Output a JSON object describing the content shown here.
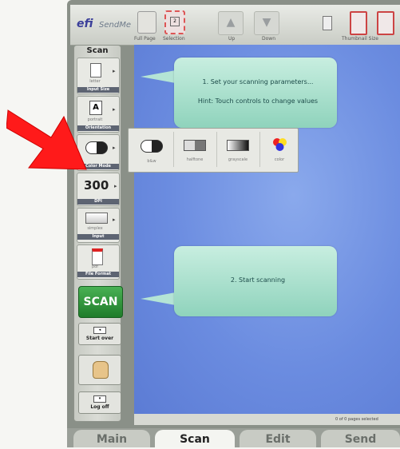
{
  "app": {
    "brand": "efi",
    "name": "SendMe"
  },
  "toolbar": {
    "full_page": "Full Page",
    "selection": "Selection",
    "up": "Up",
    "down": "Down",
    "thumbnail_size": "Thumbnail Size"
  },
  "panel": {
    "title": "Scan",
    "input_size": {
      "value": "letter",
      "caption": "Input Size"
    },
    "orientation": {
      "value": "portrait",
      "caption": "Orientation"
    },
    "color_mode": {
      "caption": "Color Mode"
    },
    "dpi": {
      "value": "300",
      "caption": "DPI"
    },
    "input": {
      "value": "simplex",
      "caption": "Input"
    },
    "file_format": {
      "value": "pdf",
      "caption": "File Format"
    },
    "scan_button": "SCAN",
    "start_over": "Start over",
    "log_off": "Log off"
  },
  "hints": {
    "step1_line1": "1. Set your scanning parameters...",
    "step1_line2": "Hint: Touch controls to change values",
    "step2": "2. Start scanning"
  },
  "color_popup": {
    "options": [
      "b&w",
      "halftone",
      "grayscale",
      "color"
    ]
  },
  "status": {
    "pages": "0 of 0 pages selected"
  },
  "tabs": [
    "Main",
    "Scan",
    "Edit",
    "Send"
  ],
  "active_tab": "Scan",
  "colors": {
    "accent_green": "#2e9a3a",
    "content_blue": "#6b8ce0",
    "annotation_arrow": "#ff1a1a",
    "hint_green": "#a9e2cf"
  },
  "icons": [
    "document-icon",
    "portrait-a-icon",
    "toggle-icon",
    "scanner-icon",
    "pdf-icon",
    "hand-icon",
    "arrow-left-icon",
    "arrow-down-icon",
    "up-arrow-icon",
    "down-arrow-icon"
  ]
}
